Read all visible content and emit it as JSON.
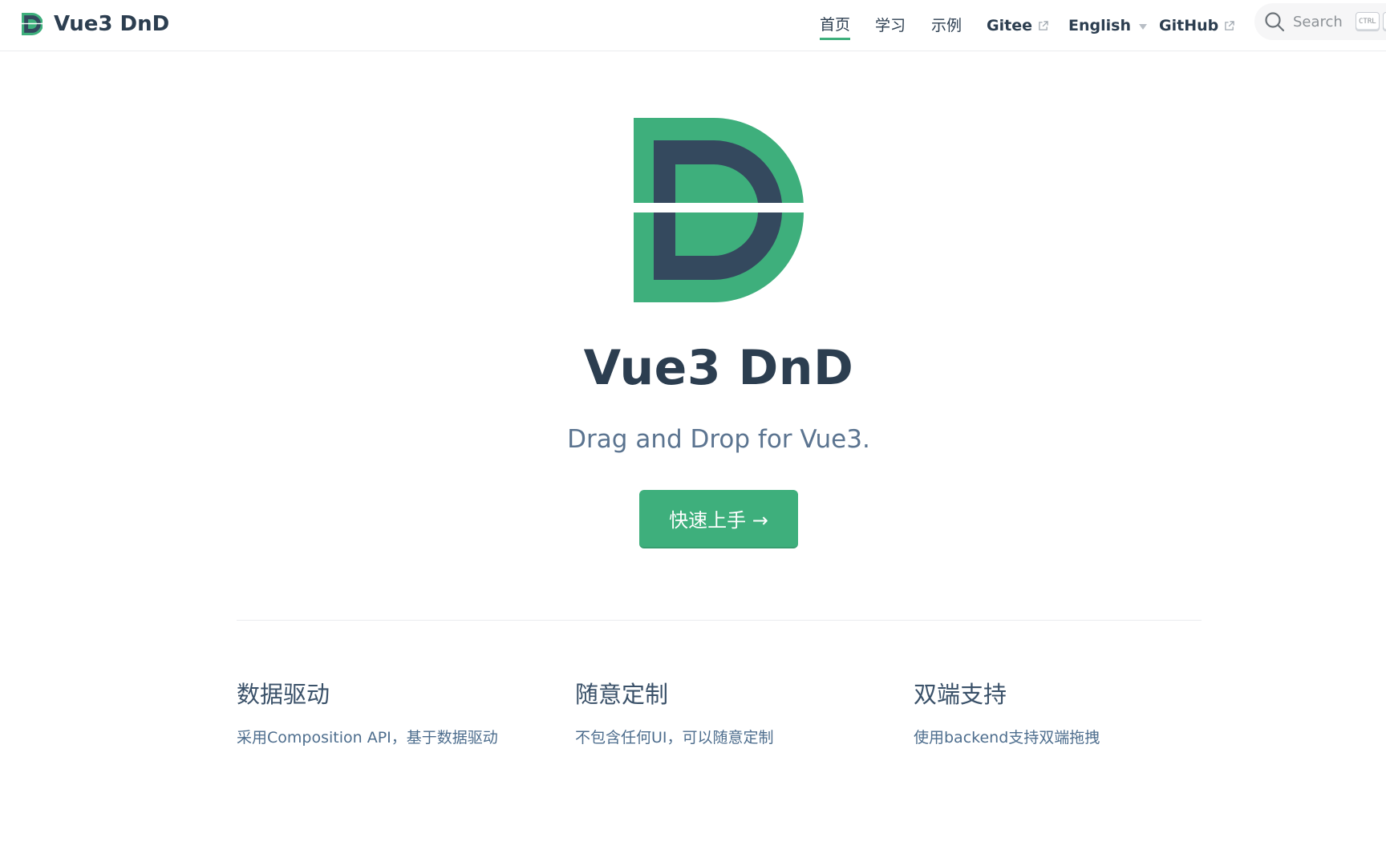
{
  "navbar": {
    "brand_title": "Vue3 DnD",
    "links": [
      {
        "label": "首页",
        "active": true
      },
      {
        "label": "学习"
      },
      {
        "label": "示例"
      },
      {
        "label": "Gitee",
        "external": true
      },
      {
        "label": "English",
        "dropdown": true
      },
      {
        "label": "GitHub",
        "external": true
      }
    ],
    "search": {
      "label": "Search",
      "shortcut": "CTRL"
    }
  },
  "hero": {
    "title": "Vue3 DnD",
    "tagline": "Drag and Drop for Vue3.",
    "cta_label": "快速上手 →"
  },
  "features": [
    {
      "title": "数据驱动",
      "desc": "采用Composition API，基于数据驱动"
    },
    {
      "title": "随意定制",
      "desc": "不包含任何UI，可以随意定制"
    },
    {
      "title": "双端支持",
      "desc": "使用backend支持双端拖拽"
    }
  ],
  "colors": {
    "accent": "#3eaf7c",
    "dark": "#2c3e50",
    "logo_navy": "#34495e"
  }
}
